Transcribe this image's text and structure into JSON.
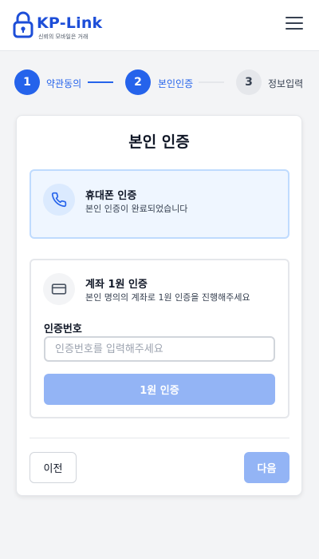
{
  "header": {
    "logo_text": "KP-Link",
    "logo_tagline": "신뢰의 모바일은 거래",
    "brand_color": "#1d4ed8"
  },
  "steps": [
    {
      "number": "1",
      "label": "약관동의",
      "state": "active"
    },
    {
      "number": "2",
      "label": "본인인증",
      "state": "active"
    },
    {
      "number": "3",
      "label": "정보입력",
      "state": "pending"
    }
  ],
  "card": {
    "title": "본인 인증",
    "phone_option": {
      "icon": "phone-icon",
      "title": "휴대폰 인증",
      "description": "본인 인증이 완료되었습니다"
    },
    "bank_option": {
      "icon": "card-icon",
      "title": "계좌 1원 인증",
      "description": "본인 명의의 계좌로 1원 인증을 진행해주세요",
      "field_label": "인증번호",
      "input_value": "",
      "input_placeholder": "인증번호를 입력해주세요",
      "button_label": "1원 인증"
    },
    "prev_label": "이전",
    "next_label": "다음"
  },
  "colors": {
    "accent": "#2563eb",
    "disabled_button": "#93b4f5",
    "selected_bg": "#eff6ff"
  }
}
